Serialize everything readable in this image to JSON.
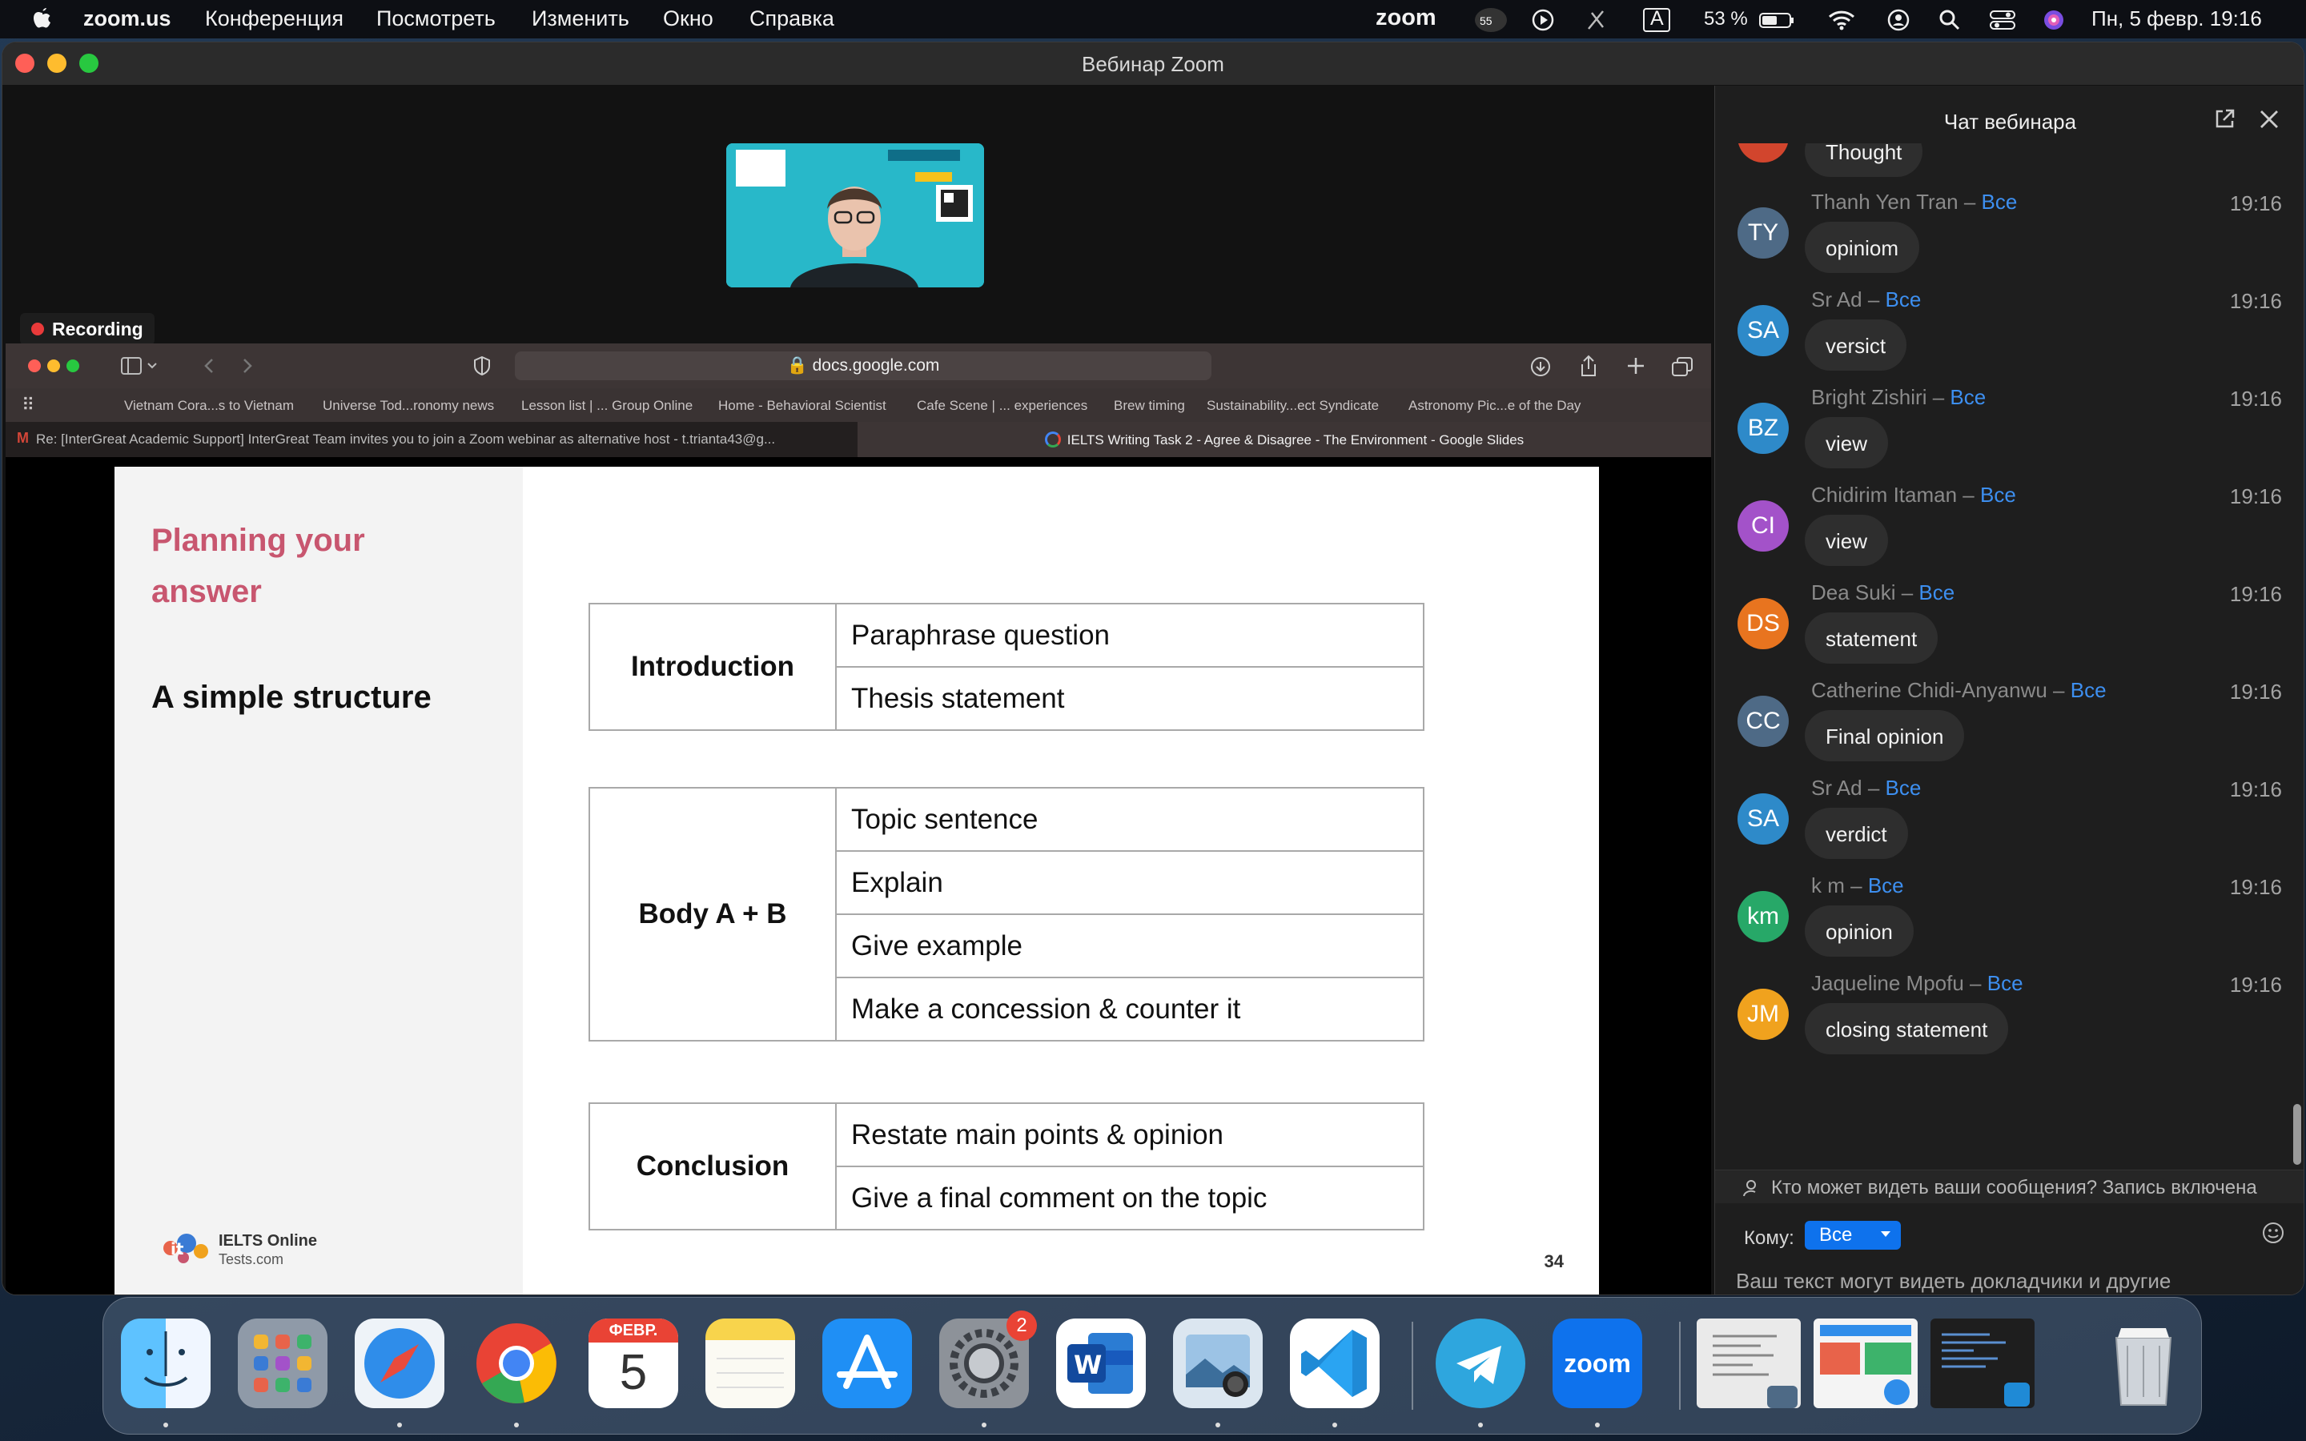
{
  "menubar": {
    "app_name": "zoom.us",
    "menus": [
      "Конференция",
      "Посмотреть",
      "Изменить",
      "Окно",
      "Справка"
    ],
    "zoom_logo_text": "zoom",
    "notification_count": "55",
    "keyboard_layout": "A",
    "battery": "53 %",
    "datetime": "Пн, 5 февр.  19:16"
  },
  "window": {
    "title": "Вебинар Zoom",
    "recording_label": "Recording"
  },
  "browser": {
    "url": "docs.google.com",
    "bookmarks": [
      "Vietnam Cora...s to Vietnam",
      "Universe Tod...ronomy news",
      "Lesson list | ... Group Online",
      "Home - Behavioral Scientist",
      "Cafe Scene | ... experiences",
      "Brew timing",
      "Sustainability...ect Syndicate",
      "Astronomy Pic...e of the Day"
    ],
    "tab_left": "Re: [InterGreat Academic Support] InterGreat Team invites you to join a Zoom webinar as alternative host - t.trianta43@g...",
    "tab_right": "IELTS Writing Task 2 - Agree & Disagree - The Environment - Google Slides"
  },
  "slide": {
    "heading": "Planning your answer",
    "subheading": "A simple structure",
    "sections": [
      {
        "name": "Introduction",
        "items": [
          "Paraphrase question",
          "Thesis statement"
        ]
      },
      {
        "name": "Body A + B",
        "items": [
          "Topic sentence",
          "Explain",
          "Give example",
          "Make a concession & counter it"
        ]
      },
      {
        "name": "Conclusion",
        "items": [
          "Restate main points & opinion",
          "Give a final comment on the topic"
        ]
      }
    ],
    "logo_line1": "IELTS Online",
    "logo_line2": "Tests.com",
    "page_number": "34"
  },
  "chat": {
    "title": "Чат вебинара",
    "partial_message": "Thought",
    "messages": [
      {
        "sender": "Thanh Yen Tran",
        "to": "Все",
        "time": "19:16",
        "initials": "TY",
        "color": "#4e6a86",
        "text": "opiniom"
      },
      {
        "sender": "Sr Ad",
        "to": "Все",
        "time": "19:16",
        "initials": "SA",
        "color": "#2e8ac9",
        "text": "versict"
      },
      {
        "sender": "Bright Zishiri",
        "to": "Все",
        "time": "19:16",
        "initials": "BZ",
        "color": "#2e8ac9",
        "text": "view"
      },
      {
        "sender": "Chidirim Itaman",
        "to": "Все",
        "time": "19:16",
        "initials": "CI",
        "color": "#a352c9",
        "text": "view"
      },
      {
        "sender": "Dea Suki",
        "to": "Все",
        "time": "19:16",
        "initials": "DS",
        "color": "#e8741f",
        "text": "statement"
      },
      {
        "sender": "Catherine Chidi-Anyanwu",
        "to": "Все",
        "time": "19:16",
        "initials": "CC",
        "color": "#4e6a86",
        "text": "Final opinion"
      },
      {
        "sender": "Sr Ad",
        "to": "Все",
        "time": "19:16",
        "initials": "SA",
        "color": "#2e8ac9",
        "text": "verdict"
      },
      {
        "sender": "k m",
        "to": "Все",
        "time": "19:16",
        "initials": "km",
        "color": "#27a868",
        "text": "opinion"
      },
      {
        "sender": "Jaqueline Mpofu",
        "to": "Все",
        "time": "19:16",
        "initials": "JM",
        "color": "#f0a21e",
        "text": "closing statement"
      }
    ],
    "separator": " – ",
    "notice": "Кто может видеть ваши сообщения? Запись включена",
    "to_label": "Кому:",
    "to_value": "Все",
    "placeholder": "Ваш текст могут видеть докладчики и другие участники"
  },
  "dock": {
    "calendar_month": "ФЕВР.",
    "calendar_day": "5",
    "settings_badge": "2",
    "zoom_label": "zoom",
    "apps": [
      "finder-icon",
      "launchpad-icon",
      "safari-icon",
      "chrome-icon",
      "calendar-icon",
      "notes-icon",
      "app-store-icon",
      "system-settings-icon",
      "word-icon",
      "preview-icon",
      "vscode-icon",
      "telegram-icon",
      "zoom-icon"
    ]
  }
}
